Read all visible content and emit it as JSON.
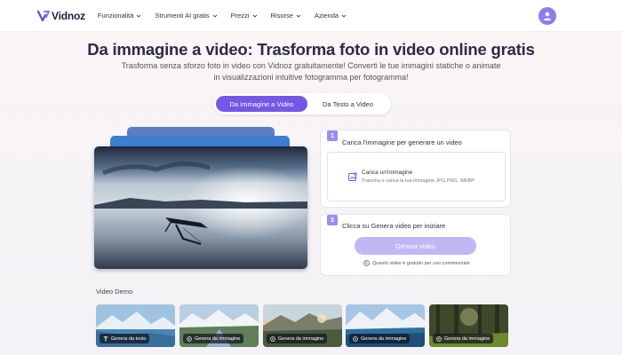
{
  "nav": {
    "logo": "Vidnoz",
    "items": [
      {
        "label": "Funzionalità"
      },
      {
        "label": "Strumenti AI gratis"
      },
      {
        "label": "Prezzi"
      },
      {
        "label": "Risorse"
      },
      {
        "label": "Azienda"
      }
    ]
  },
  "hero": {
    "title": "Da immagine a video: Trasforma foto in video online gratis",
    "subtitle_line1": "Trasforma senza sforzo foto in video con Vidnoz gratuitamente! Converti le tue immagini statiche o animate",
    "subtitle_line2": "in visualizzazioni intuitive fotogramma per fotogramma!"
  },
  "tabs": [
    {
      "label": "Da Immagine a Video",
      "active": true
    },
    {
      "label": "Da Testo a Video",
      "active": false
    }
  ],
  "step1": {
    "number": "1",
    "title": "Carica l'immagine per generare un video",
    "upload_title": "Carica un'immagine",
    "upload_hint": "Trascina o carica la tua immagine JPG,PNG, WEBP"
  },
  "step2": {
    "number": "2",
    "title": "Clicca su Genera video per iniziare",
    "button": "Genera video",
    "note": "Questo video è gratuito per uso commerciale"
  },
  "demo": {
    "label": "Video Demo",
    "items": [
      {
        "label": "Genera da testo",
        "icon": "text-icon"
      },
      {
        "label": "Genera da immagine",
        "icon": "image-icon"
      },
      {
        "label": "Genera da immagine",
        "icon": "image-icon"
      },
      {
        "label": "Genera da immagine",
        "icon": "image-icon"
      },
      {
        "label": "Genera da immagine",
        "icon": "image-icon"
      }
    ]
  },
  "colors": {
    "accent": "#7358e8",
    "button_disabled": "#c3b6f5",
    "step_badge": "#9b8cf2"
  }
}
